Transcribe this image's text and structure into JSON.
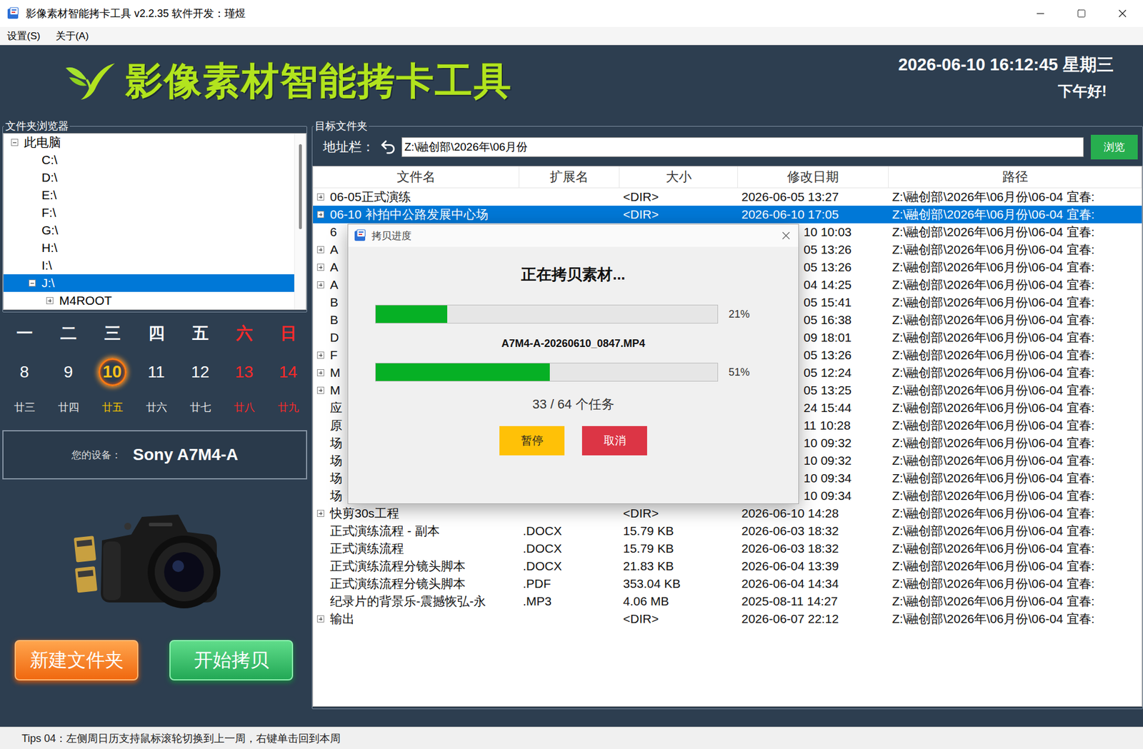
{
  "window": {
    "title": "影像素材智能拷卡工具 v2.2.35  软件开发：瑾煜"
  },
  "menu": [
    {
      "label": "设置(S)"
    },
    {
      "label": "关于(A)"
    }
  ],
  "header": {
    "title": "影像素材智能拷卡工具",
    "datetime": "2026-06-10 16:12:45 星期三",
    "greeting": "下午好!"
  },
  "folder_browser": {
    "title": "文件夹浏览器",
    "items": [
      {
        "label": "此电脑",
        "level": 0,
        "expandable": true,
        "expanded": true,
        "selected": false
      },
      {
        "label": "C:\\",
        "level": 1,
        "expandable": false,
        "expanded": false,
        "selected": false
      },
      {
        "label": "D:\\",
        "level": 1,
        "expandable": false,
        "expanded": false,
        "selected": false
      },
      {
        "label": "E:\\",
        "level": 1,
        "expandable": false,
        "expanded": false,
        "selected": false
      },
      {
        "label": "F:\\",
        "level": 1,
        "expandable": false,
        "expanded": false,
        "selected": false
      },
      {
        "label": "G:\\",
        "level": 1,
        "expandable": false,
        "expanded": false,
        "selected": false
      },
      {
        "label": "H:\\",
        "level": 1,
        "expandable": false,
        "expanded": false,
        "selected": false
      },
      {
        "label": "I:\\",
        "level": 1,
        "expandable": false,
        "expanded": false,
        "selected": false
      },
      {
        "label": "J:\\",
        "level": 1,
        "expandable": true,
        "expanded": true,
        "selected": true
      },
      {
        "label": "M4ROOT",
        "level": 2,
        "expandable": true,
        "expanded": false,
        "selected": false
      }
    ]
  },
  "calendar": {
    "days": [
      {
        "weekday": "一",
        "date": "8",
        "lunar": "廿三",
        "weekend": false,
        "today": false
      },
      {
        "weekday": "二",
        "date": "9",
        "lunar": "廿四",
        "weekend": false,
        "today": false
      },
      {
        "weekday": "三",
        "date": "10",
        "lunar": "廿五",
        "weekend": false,
        "today": true
      },
      {
        "weekday": "四",
        "date": "11",
        "lunar": "廿六",
        "weekend": false,
        "today": false
      },
      {
        "weekday": "五",
        "date": "12",
        "lunar": "廿七",
        "weekend": false,
        "today": false
      },
      {
        "weekday": "六",
        "date": "13",
        "lunar": "廿八",
        "weekend": true,
        "today": false
      },
      {
        "weekday": "日",
        "date": "14",
        "lunar": "廿九",
        "weekend": true,
        "today": false
      }
    ]
  },
  "device": {
    "label": "您的设备：",
    "name": "Sony A7M4-A"
  },
  "actions": [
    {
      "label": "新建文件夹",
      "kind": "accent"
    },
    {
      "label": "开始拷贝",
      "kind": "primary"
    }
  ],
  "target": {
    "title": "目标文件夹",
    "address_label": "地址栏：",
    "address": "Z:\\融创部\\2026年\\06月份",
    "browse": "浏览"
  },
  "table": {
    "columns": [
      {
        "label": "文件名"
      },
      {
        "label": "扩展名"
      },
      {
        "label": "大小"
      },
      {
        "label": "修改日期"
      },
      {
        "label": "路径"
      }
    ],
    "rows": [
      {
        "name": "06-05正式演练",
        "ext": "",
        "size": "<DIR>",
        "modified": "2026-06-05 13:27",
        "path": "Z:\\融创部\\2026年\\06月份\\06-04 宜春:",
        "expandable": true,
        "selected": false,
        "covered": false
      },
      {
        "name": "06-10 补拍中公路发展中心场",
        "ext": "",
        "size": "<DIR>",
        "modified": "2026-06-10 17:05",
        "path": "Z:\\融创部\\2026年\\06月份\\06-04 宜春:",
        "expandable": true,
        "selected": true,
        "covered": false
      },
      {
        "name": "6",
        "ext": "",
        "size": "",
        "modified": "10 10:03",
        "path": "Z:\\融创部\\2026年\\06月份\\06-04 宜春:",
        "expandable": false,
        "selected": false,
        "covered": true
      },
      {
        "name": "A",
        "ext": "",
        "size": "",
        "modified": "05 13:26",
        "path": "Z:\\融创部\\2026年\\06月份\\06-04 宜春:",
        "expandable": true,
        "selected": false,
        "covered": true
      },
      {
        "name": "A",
        "ext": "",
        "size": "",
        "modified": "05 13:26",
        "path": "Z:\\融创部\\2026年\\06月份\\06-04 宜春:",
        "expandable": true,
        "selected": false,
        "covered": true
      },
      {
        "name": "A",
        "ext": "",
        "size": "",
        "modified": "04 14:25",
        "path": "Z:\\融创部\\2026年\\06月份\\06-04 宜春:",
        "expandable": true,
        "selected": false,
        "covered": true
      },
      {
        "name": "B",
        "ext": "",
        "size": "",
        "modified": "05 15:41",
        "path": "Z:\\融创部\\2026年\\06月份\\06-04 宜春:",
        "expandable": false,
        "selected": false,
        "covered": true
      },
      {
        "name": "B",
        "ext": "",
        "size": "",
        "modified": "05 16:38",
        "path": "Z:\\融创部\\2026年\\06月份\\06-04 宜春:",
        "expandable": false,
        "selected": false,
        "covered": true
      },
      {
        "name": "D",
        "ext": "",
        "size": "",
        "modified": "09 18:01",
        "path": "Z:\\融创部\\2026年\\06月份\\06-04 宜春:",
        "expandable": false,
        "selected": false,
        "covered": true
      },
      {
        "name": "F",
        "ext": "",
        "size": "",
        "modified": "05 13:26",
        "path": "Z:\\融创部\\2026年\\06月份\\06-04 宜春:",
        "expandable": true,
        "selected": false,
        "covered": true
      },
      {
        "name": "M",
        "ext": "",
        "size": "",
        "modified": "05 12:24",
        "path": "Z:\\融创部\\2026年\\06月份\\06-04 宜春:",
        "expandable": true,
        "selected": false,
        "covered": true
      },
      {
        "name": "M",
        "ext": "",
        "size": "",
        "modified": "05 13:25",
        "path": "Z:\\融创部\\2026年\\06月份\\06-04 宜春:",
        "expandable": true,
        "selected": false,
        "covered": true
      },
      {
        "name": "应",
        "ext": "",
        "size": "",
        "modified": "24 15:44",
        "path": "Z:\\融创部\\2026年\\06月份\\06-04 宜春:",
        "expandable": false,
        "selected": false,
        "covered": true
      },
      {
        "name": "原",
        "ext": "",
        "size": "",
        "modified": "11 10:28",
        "path": "Z:\\融创部\\2026年\\06月份\\06-04 宜春:",
        "expandable": false,
        "selected": false,
        "covered": true
      },
      {
        "name": "场",
        "ext": "",
        "size": "",
        "modified": "10 09:32",
        "path": "Z:\\融创部\\2026年\\06月份\\06-04 宜春:",
        "expandable": false,
        "selected": false,
        "covered": true
      },
      {
        "name": "场",
        "ext": "",
        "size": "",
        "modified": "10 09:32",
        "path": "Z:\\融创部\\2026年\\06月份\\06-04 宜春:",
        "expandable": false,
        "selected": false,
        "covered": true
      },
      {
        "name": "场",
        "ext": "",
        "size": "",
        "modified": "10 09:34",
        "path": "Z:\\融创部\\2026年\\06月份\\06-04 宜春:",
        "expandable": false,
        "selected": false,
        "covered": true
      },
      {
        "name": "场",
        "ext": "",
        "size": "",
        "modified": "10 09:34",
        "path": "Z:\\融创部\\2026年\\06月份\\06-04 宜春:",
        "expandable": false,
        "selected": false,
        "covered": true
      },
      {
        "name": "快剪30s工程",
        "ext": "",
        "size": "<DIR>",
        "modified": "2026-06-10 14:28",
        "path": "Z:\\融创部\\2026年\\06月份\\06-04 宜春:",
        "expandable": true,
        "selected": false,
        "covered": false
      },
      {
        "name": "正式演练流程 - 副本",
        "ext": ".DOCX",
        "size": "15.79 KB",
        "modified": "2026-06-03 18:32",
        "path": "Z:\\融创部\\2026年\\06月份\\06-04 宜春:",
        "expandable": false,
        "selected": false,
        "covered": false
      },
      {
        "name": "正式演练流程",
        "ext": ".DOCX",
        "size": "15.79 KB",
        "modified": "2026-06-03 18:32",
        "path": "Z:\\融创部\\2026年\\06月份\\06-04 宜春:",
        "expandable": false,
        "selected": false,
        "covered": false
      },
      {
        "name": "正式演练流程分镜头脚本",
        "ext": ".DOCX",
        "size": "21.83 KB",
        "modified": "2026-06-04 13:39",
        "path": "Z:\\融创部\\2026年\\06月份\\06-04 宜春:",
        "expandable": false,
        "selected": false,
        "covered": false
      },
      {
        "name": "正式演练流程分镜头脚本",
        "ext": ".PDF",
        "size": "353.04 KB",
        "modified": "2026-06-04 14:34",
        "path": "Z:\\融创部\\2026年\\06月份\\06-04 宜春:",
        "expandable": false,
        "selected": false,
        "covered": false
      },
      {
        "name": "纪录片的背景乐-震撼恢弘-永",
        "ext": ".MP3",
        "size": "4.06 MB",
        "modified": "2025-08-11 14:27",
        "path": "Z:\\融创部\\2026年\\06月份\\06-04 宜春:",
        "expandable": false,
        "selected": false,
        "covered": false
      },
      {
        "name": "输出",
        "ext": "",
        "size": "<DIR>",
        "modified": "2026-06-07 22:12",
        "path": "Z:\\融创部\\2026年\\06月份\\06-04 宜春:",
        "expandable": true,
        "selected": false,
        "covered": false
      }
    ]
  },
  "dialog": {
    "title": "拷贝进度",
    "heading": "正在拷贝素材...",
    "overall": {
      "level": 0.21,
      "reading": "21%"
    },
    "file": "A7M4-A-20260610_0847.MP4",
    "file_progress": {
      "level": 0.51,
      "reading": "51%"
    },
    "tasks": "33 / 64 个任务",
    "buttons": [
      {
        "label": "暂停",
        "kind": "pause"
      },
      {
        "label": "取消",
        "kind": "cancel"
      }
    ]
  },
  "status_bar": "Tips 04：左侧周日历支持鼠标滚轮切换到上一周，右键单击回到本周"
}
